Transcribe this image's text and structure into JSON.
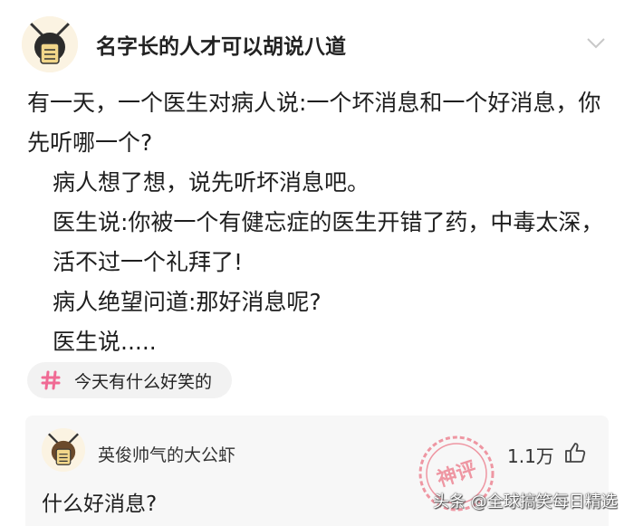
{
  "post": {
    "author": "名字长的人才可以胡说八道",
    "lines": [
      "有一天，一个医生对病人说:一个坏消息和一个好消息，你先听哪一个?",
      "病人想了想，说先听坏消息吧。",
      "医生说:你被一个有健忘症的医生开错了药，中毒太深，活不过一个礼拜了!",
      "病人绝望问道:那好消息呢?",
      "医生说....."
    ]
  },
  "topic": {
    "label": "今天有什么好笑的",
    "icon": "hash-icon"
  },
  "comment": {
    "author": "英俊帅气的大公虾",
    "likes": "1.1万",
    "text": "什么好消息?",
    "stamp": "神评"
  },
  "watermark": "头条 @全球搞笑每日精选",
  "colors": {
    "accent_pink": "#f06a94",
    "stamp_red": "#e8475d",
    "card_bg": "#f7f7f7"
  }
}
